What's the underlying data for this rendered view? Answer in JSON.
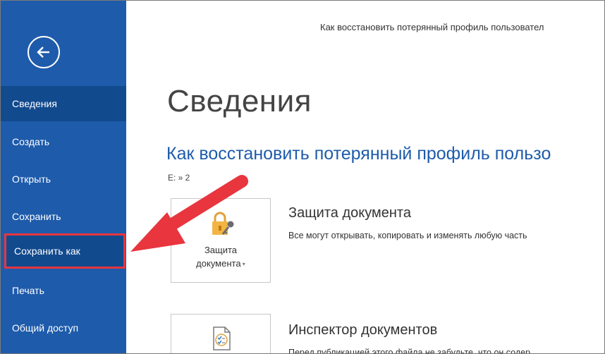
{
  "window": {
    "title": "Как восстановить потерянный профиль пользовател"
  },
  "sidebar": {
    "items": [
      {
        "label": "Сведения",
        "active": true
      },
      {
        "label": "Создать"
      },
      {
        "label": "Открыть"
      },
      {
        "label": "Сохранить"
      },
      {
        "label": "Сохранить как",
        "highlighted": true
      },
      {
        "label": "Печать"
      },
      {
        "label": "Общий доступ"
      }
    ]
  },
  "main": {
    "page_title": "Сведения",
    "doc_title": "Как восстановить потерянный профиль пользо",
    "doc_path": "E: » 2",
    "protect": {
      "button_line1": "Защита",
      "button_line2": "документа",
      "heading": "Защита документа",
      "description": "Все могут открывать, копировать и изменять любую часть"
    },
    "inspect": {
      "heading": "Инспектор документов",
      "description": "Перед публикацией этого файла не забудьте, что он содер"
    }
  },
  "colors": {
    "sidebar_bg": "#1e5bab",
    "sidebar_active": "#124a8e",
    "accent_red": "#e8353e",
    "doc_title": "#1e5bab"
  },
  "icons": {
    "back": "back-arrow-icon",
    "protect": "lock-key-icon",
    "inspect": "document-checklist-icon",
    "dropdown": "caret-down-icon"
  }
}
